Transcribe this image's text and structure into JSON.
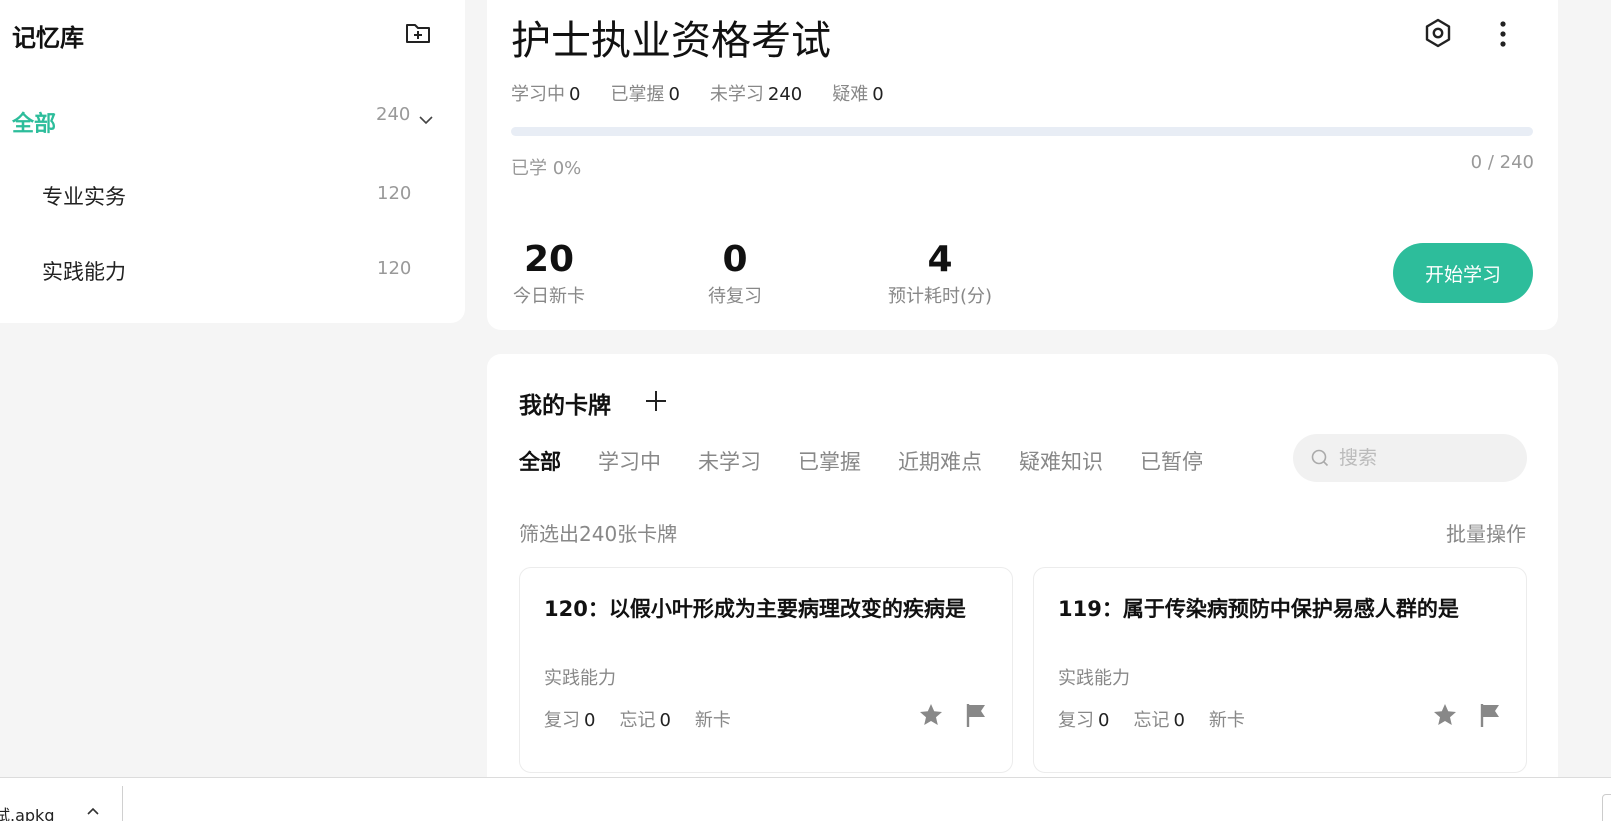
{
  "sidebar": {
    "title": "记忆库",
    "all": {
      "label": "全部",
      "count": "240"
    },
    "items": [
      {
        "label": "专业实务",
        "count": "120"
      },
      {
        "label": "实践能力",
        "count": "120"
      }
    ]
  },
  "deck": {
    "title": "护士执业资格考试",
    "stats": [
      {
        "label": "学习中",
        "value": "0"
      },
      {
        "label": "已掌握",
        "value": "0"
      },
      {
        "label": "未学习",
        "value": "240"
      },
      {
        "label": "疑难",
        "value": "0"
      }
    ],
    "progress_fraction": 0,
    "learned_pct": "已学 0%",
    "learned_ratio": "0 / 240",
    "metrics": [
      {
        "value": "20",
        "caption": "今日新卡"
      },
      {
        "value": "0",
        "caption": "待复习"
      },
      {
        "value": "4",
        "caption": "预计耗时(分)"
      }
    ],
    "start_label": "开始学习"
  },
  "cards_section": {
    "title": "我的卡牌",
    "tabs": [
      "全部",
      "学习中",
      "未学习",
      "已掌握",
      "近期难点",
      "疑难知识",
      "已暂停"
    ],
    "active_tab": 0,
    "search_placeholder": "搜索",
    "filter_count": "筛选出240张卡牌",
    "batch_label": "批量操作",
    "cards": [
      {
        "question": "120：以假小叶形成为主要病理改变的疾病是",
        "tag": "实践能力",
        "review_label": "复习",
        "review_value": "0",
        "forget_label": "忘记",
        "forget_value": "0",
        "status": "新卡"
      },
      {
        "question": "119：属于传染病预防中保护易感人群的是",
        "tag": "实践能力",
        "review_label": "复习",
        "review_value": "0",
        "forget_label": "忘记",
        "forget_value": "0",
        "status": "新卡"
      }
    ]
  },
  "download_bar": {
    "file_name": "试.apkg"
  },
  "colors": {
    "accent": "#2dbd9b",
    "progress_track": "#e8edf5"
  }
}
